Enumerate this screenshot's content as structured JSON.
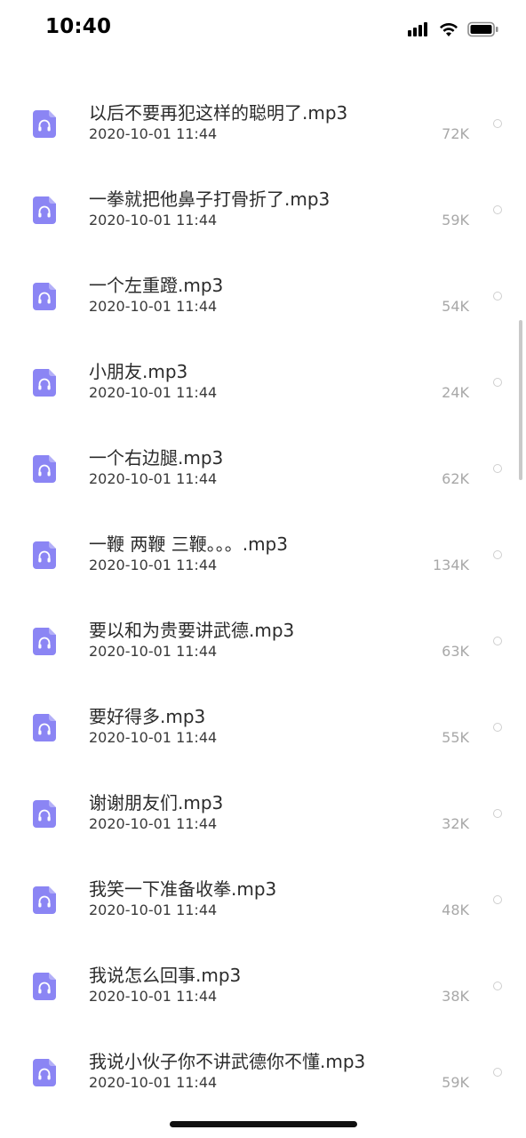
{
  "status_bar": {
    "time": "10:40",
    "icons": [
      "cellular-signal-icon",
      "wifi-icon",
      "battery-icon"
    ]
  },
  "colors": {
    "file_icon": "#8b85f4",
    "text_primary": "#2b2b2b",
    "text_secondary": "#3a3a3a",
    "text_muted": "#a8a8a8"
  },
  "files": [
    {
      "name": "以后不要再犯这样的聪明了.mp3",
      "date": "2020-10-01 11:44",
      "size": "72K"
    },
    {
      "name": "一拳就把他鼻子打骨折了.mp3",
      "date": "2020-10-01 11:44",
      "size": "59K"
    },
    {
      "name": "一个左重蹬.mp3",
      "date": "2020-10-01 11:44",
      "size": "54K"
    },
    {
      "name": "小朋友.mp3",
      "date": "2020-10-01 11:44",
      "size": "24K"
    },
    {
      "name": "一个右边腿.mp3",
      "date": "2020-10-01 11:44",
      "size": "62K"
    },
    {
      "name": "一鞭 两鞭 三鞭。。。.mp3",
      "date": "2020-10-01 11:44",
      "size": "134K"
    },
    {
      "name": "要以和为贵要讲武德.mp3",
      "date": "2020-10-01 11:44",
      "size": "63K"
    },
    {
      "name": "要好得多.mp3",
      "date": "2020-10-01 11:44",
      "size": "55K"
    },
    {
      "name": "谢谢朋友们.mp3",
      "date": "2020-10-01 11:44",
      "size": "32K"
    },
    {
      "name": "我笑一下准备收拳.mp3",
      "date": "2020-10-01 11:44",
      "size": "48K"
    },
    {
      "name": "我说怎么回事.mp3",
      "date": "2020-10-01 11:44",
      "size": "38K"
    },
    {
      "name": "我说小伙子你不讲武德你不懂.mp3",
      "date": "2020-10-01 11:44",
      "size": "59K"
    }
  ]
}
